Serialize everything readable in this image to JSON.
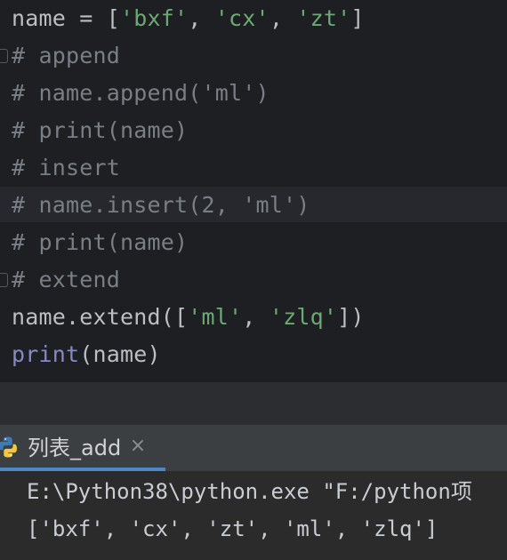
{
  "editor": {
    "lines": [
      [
        {
          "t": "name = [",
          "c": "plain"
        },
        {
          "t": "'bxf'",
          "c": "string"
        },
        {
          "t": ", ",
          "c": "plain"
        },
        {
          "t": "'cx'",
          "c": "string"
        },
        {
          "t": ", ",
          "c": "plain"
        },
        {
          "t": "'zt'",
          "c": "string"
        },
        {
          "t": "]",
          "c": "plain"
        }
      ],
      [
        {
          "t": "# append",
          "c": "comment"
        }
      ],
      [
        {
          "t": "# name.append('ml')",
          "c": "comment"
        }
      ],
      [
        {
          "t": "# print(name)",
          "c": "comment"
        }
      ],
      [
        {
          "t": "# insert",
          "c": "comment"
        }
      ],
      [
        {
          "t": "# name.insert(2, 'ml')",
          "c": "comment"
        }
      ],
      [
        {
          "t": "# print(name)",
          "c": "comment"
        }
      ],
      [
        {
          "t": "# extend",
          "c": "comment"
        }
      ],
      [
        {
          "t": "name.extend([",
          "c": "plain"
        },
        {
          "t": "'ml'",
          "c": "string"
        },
        {
          "t": ", ",
          "c": "plain"
        },
        {
          "t": "'zlq'",
          "c": "string"
        },
        {
          "t": "])",
          "c": "plain"
        }
      ],
      [
        {
          "t": "print",
          "c": "builtin"
        },
        {
          "t": "(name)",
          "c": "plain"
        }
      ]
    ]
  },
  "run_panel": {
    "tab_label": "列表_add",
    "close_glyph": "×",
    "output": [
      "E:\\Python38\\python.exe \"F:/python项",
      "['bxf', 'cx', 'zt', 'ml', 'zlq']"
    ]
  },
  "colors": {
    "editor_bg": "#1e1f22",
    "string": "#6aab73",
    "comment": "#7a7e85",
    "builtin": "#8888c6",
    "tab_accent": "#4a88c7"
  }
}
